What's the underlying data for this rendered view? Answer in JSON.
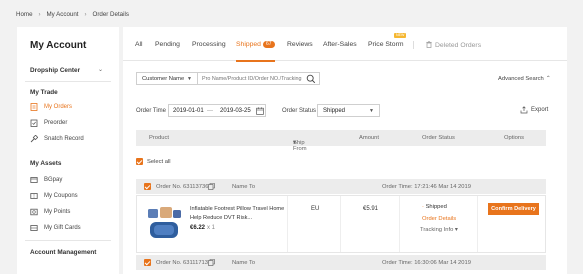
{
  "breadcrumb": {
    "items": [
      "Home",
      "My Account",
      "Order Details"
    ]
  },
  "sidebar": {
    "title": "My Account",
    "dropship": "Dropship Center",
    "my_trade": "My Trade",
    "trade_items": [
      "My Orders",
      "Preorder",
      "Snatch Record"
    ],
    "my_assets": "My Assets",
    "asset_items": [
      "BGpay",
      "My Coupons",
      "My Points",
      "My Gift Cards"
    ],
    "account_management": "Account Management"
  },
  "tabs": {
    "all": "All",
    "pending": "Pending",
    "processing": "Processing",
    "shipped": "Shipped",
    "shipped_count": "67",
    "reviews": "Reviews",
    "after_sales": "After-Sales",
    "price_storm": "Price Storm",
    "new_badge": "NEW",
    "deleted_orders": "Deleted Orders"
  },
  "filters": {
    "search_type": "Customer Name",
    "search_placeholder": "Pro Name/Product ID/Order NO./Tracking",
    "advanced_search": "Advanced Search",
    "order_time_label": "Order Time",
    "date_from": "2019-01-01",
    "date_to": "2019-03-25",
    "order_status_label": "Order Status",
    "order_status_value": "Shipped",
    "export": "Export"
  },
  "table": {
    "headers": {
      "product": "Product",
      "ship_from": "Ship From",
      "amount": "Amount",
      "order_status": "Order Status",
      "options": "Options"
    },
    "select_all": "Select all"
  },
  "orders": [
    {
      "order_no": "Order No. 63113736",
      "name_to": "Name To",
      "order_time": "Order Time: 17:21:46 Mar 14 2019",
      "product_name": "Inflatable Footrest Pillow Travel Home Help Reduce DVT Risk...",
      "price": "€6.22",
      "qty": "x 1",
      "ship_from": "EU",
      "amount": "€5.91",
      "status": "Shipped",
      "order_details": "Order Details",
      "tracking": "Tracking Info",
      "action": "Confirm Delivery"
    },
    {
      "order_no": "Order No. 63111713",
      "name_to": "Name To",
      "order_time": "Order Time: 16:30:06 Mar 14 2019"
    }
  ],
  "colors": {
    "accent": "#e8741c",
    "badge_new": "#f5b731"
  }
}
